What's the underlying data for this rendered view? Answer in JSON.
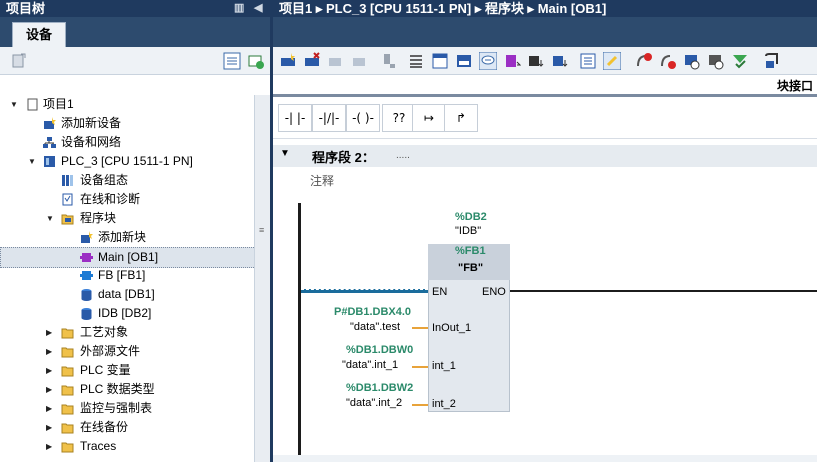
{
  "left_panel": {
    "title": "项目树",
    "tab": "设备",
    "tree": [
      {
        "label": "项目1",
        "icon": "project-icon"
      },
      {
        "label": "添加新设备",
        "icon": "add-device-icon"
      },
      {
        "label": "设备和网络",
        "icon": "network-icon"
      },
      {
        "label": "PLC_3 [CPU 1511-1 PN]",
        "icon": "plc-icon"
      },
      {
        "label": "设备组态",
        "icon": "device-config-icon"
      },
      {
        "label": "在线和诊断",
        "icon": "diagnostics-icon"
      },
      {
        "label": "程序块",
        "icon": "folder-icon"
      },
      {
        "label": "添加新块",
        "icon": "add-block-icon"
      },
      {
        "label": "Main [OB1]",
        "icon": "ob-block-icon"
      },
      {
        "label": "FB [FB1]",
        "icon": "fb-block-icon"
      },
      {
        "label": "data [DB1]",
        "icon": "db-block-icon"
      },
      {
        "label": "IDB [DB2]",
        "icon": "db-block-icon"
      },
      {
        "label": "工艺对象",
        "icon": "folder-icon"
      },
      {
        "label": "外部源文件",
        "icon": "folder-icon"
      },
      {
        "label": "PLC 变量",
        "icon": "folder-icon"
      },
      {
        "label": "PLC 数据类型",
        "icon": "folder-icon"
      },
      {
        "label": "监控与强制表",
        "icon": "folder-icon"
      },
      {
        "label": "在线备份",
        "icon": "folder-icon"
      },
      {
        "label": "Traces",
        "icon": "folder-icon"
      }
    ]
  },
  "editor": {
    "breadcrumb": "项目1 ▸ PLC_3 [CPU 1511-1 PN] ▸ 程序块 ▸ Main [OB1]",
    "interface_label": "块接口",
    "lad_buttons": [
      "-| |-",
      "-|/|-",
      "-( )-",
      "??",
      "↦",
      "↱"
    ],
    "network_title": "程序段 2：",
    "network_dots": ".....",
    "comment": "注释",
    "instance_db_address": "%DB2",
    "instance_db_name": "\"IDB\"",
    "fb_address": "%FB1",
    "fb_name": "\"FB\"",
    "pin_en": "EN",
    "pin_eno": "ENO",
    "params": [
      {
        "address": "P#DB1.DBX4.0",
        "operand": "\"data\".test",
        "pin": "InOut_1"
      },
      {
        "address": "%DB1.DBW0",
        "operand": "\"data\".int_1",
        "pin": "int_1"
      },
      {
        "address": "%DB1.DBW2",
        "operand": "\"data\".int_2",
        "pin": "int_2"
      }
    ]
  },
  "colors": {
    "title_bar": "#1f3a5f",
    "address_blue": "#1a6c9c",
    "address_green": "#2b8a6a",
    "fb_box": "#e3e8ee",
    "pin_connector": "#e8a33a"
  }
}
